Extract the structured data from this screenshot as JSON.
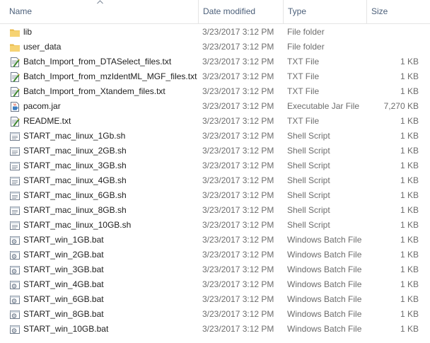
{
  "columns": {
    "name": "Name",
    "date": "Date modified",
    "type": "Type",
    "size": "Size"
  },
  "files": [
    {
      "name": "lib",
      "date": "3/23/2017 3:12 PM",
      "type": "File folder",
      "size": "",
      "icon": "folder-icon"
    },
    {
      "name": "user_data",
      "date": "3/23/2017 3:12 PM",
      "type": "File folder",
      "size": "",
      "icon": "folder-icon"
    },
    {
      "name": "Batch_Import_from_DTASelect_files.txt",
      "date": "3/23/2017 3:12 PM",
      "type": "TXT File",
      "size": "1 KB",
      "icon": "text-file-icon"
    },
    {
      "name": "Batch_Import_from_mzIdentML_MGF_files.txt",
      "date": "3/23/2017 3:12 PM",
      "type": "TXT File",
      "size": "1 KB",
      "icon": "text-file-icon"
    },
    {
      "name": "Batch_Import_from_Xtandem_files.txt",
      "date": "3/23/2017 3:12 PM",
      "type": "TXT File",
      "size": "1 KB",
      "icon": "text-file-icon"
    },
    {
      "name": "pacom.jar",
      "date": "3/23/2017 3:12 PM",
      "type": "Executable Jar File",
      "size": "7,270 KB",
      "icon": "jar-file-icon"
    },
    {
      "name": "README.txt",
      "date": "3/23/2017 3:12 PM",
      "type": "TXT File",
      "size": "1 KB",
      "icon": "text-file-icon"
    },
    {
      "name": "START_mac_linux_1Gb.sh",
      "date": "3/23/2017 3:12 PM",
      "type": "Shell Script",
      "size": "1 KB",
      "icon": "script-file-icon"
    },
    {
      "name": "START_mac_linux_2GB.sh",
      "date": "3/23/2017 3:12 PM",
      "type": "Shell Script",
      "size": "1 KB",
      "icon": "script-file-icon"
    },
    {
      "name": "START_mac_linux_3GB.sh",
      "date": "3/23/2017 3:12 PM",
      "type": "Shell Script",
      "size": "1 KB",
      "icon": "script-file-icon"
    },
    {
      "name": "START_mac_linux_4GB.sh",
      "date": "3/23/2017 3:12 PM",
      "type": "Shell Script",
      "size": "1 KB",
      "icon": "script-file-icon"
    },
    {
      "name": "START_mac_linux_6GB.sh",
      "date": "3/23/2017 3:12 PM",
      "type": "Shell Script",
      "size": "1 KB",
      "icon": "script-file-icon"
    },
    {
      "name": "START_mac_linux_8GB.sh",
      "date": "3/23/2017 3:12 PM",
      "type": "Shell Script",
      "size": "1 KB",
      "icon": "script-file-icon"
    },
    {
      "name": "START_mac_linux_10GB.sh",
      "date": "3/23/2017 3:12 PM",
      "type": "Shell Script",
      "size": "1 KB",
      "icon": "script-file-icon"
    },
    {
      "name": "START_win_1GB.bat",
      "date": "3/23/2017 3:12 PM",
      "type": "Windows Batch File",
      "size": "1 KB",
      "icon": "batch-file-icon"
    },
    {
      "name": "START_win_2GB.bat",
      "date": "3/23/2017 3:12 PM",
      "type": "Windows Batch File",
      "size": "1 KB",
      "icon": "batch-file-icon"
    },
    {
      "name": "START_win_3GB.bat",
      "date": "3/23/2017 3:12 PM",
      "type": "Windows Batch File",
      "size": "1 KB",
      "icon": "batch-file-icon"
    },
    {
      "name": "START_win_4GB.bat",
      "date": "3/23/2017 3:12 PM",
      "type": "Windows Batch File",
      "size": "1 KB",
      "icon": "batch-file-icon"
    },
    {
      "name": "START_win_6GB.bat",
      "date": "3/23/2017 3:12 PM",
      "type": "Windows Batch File",
      "size": "1 KB",
      "icon": "batch-file-icon"
    },
    {
      "name": "START_win_8GB.bat",
      "date": "3/23/2017 3:12 PM",
      "type": "Windows Batch File",
      "size": "1 KB",
      "icon": "batch-file-icon"
    },
    {
      "name": "START_win_10GB.bat",
      "date": "3/23/2017 3:12 PM",
      "type": "Windows Batch File",
      "size": "1 KB",
      "icon": "batch-file-icon"
    }
  ],
  "colors": {
    "header_text": "#4c607a",
    "name_text": "#1e1e1e",
    "detail_text": "#6d6d6d",
    "folder": "#f0c75e",
    "divider": "#e5e5e5"
  }
}
